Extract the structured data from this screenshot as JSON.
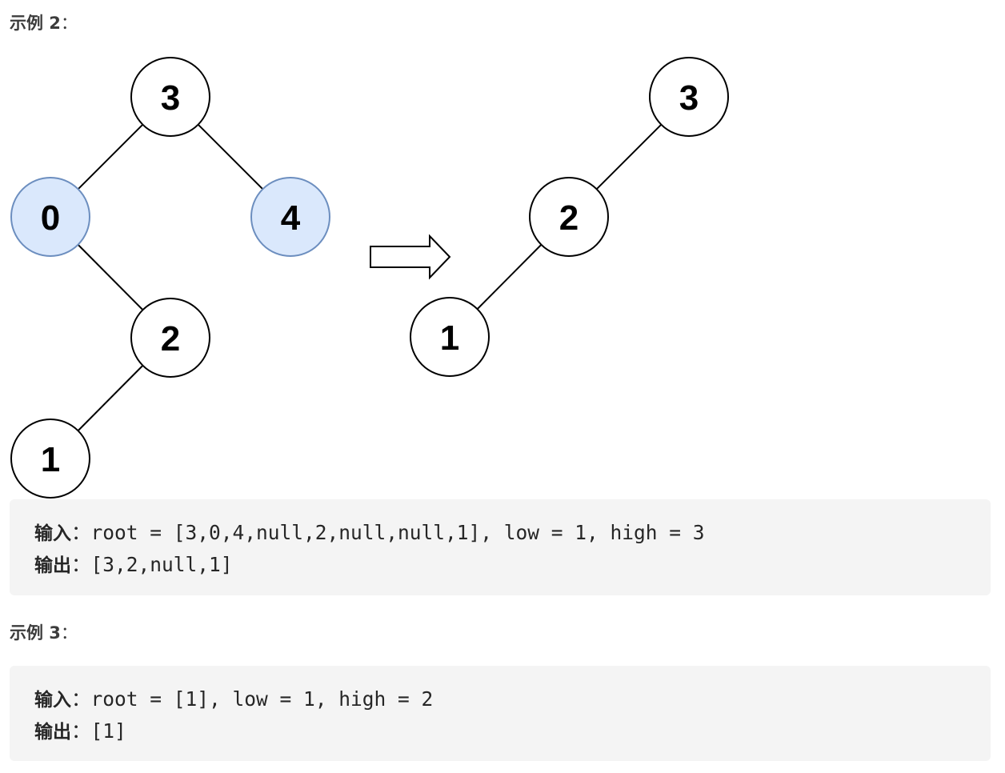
{
  "example2": {
    "heading": "示例 2",
    "colon": "：",
    "diagram": {
      "colors": {
        "highlight_fill": "#dae8fc",
        "highlight_stroke": "#6c8ebf",
        "node_stroke": "#000000"
      },
      "before_tree": {
        "nodes": [
          {
            "id": "a",
            "value": "3",
            "highlighted": false
          },
          {
            "id": "b",
            "value": "0",
            "highlighted": true
          },
          {
            "id": "c",
            "value": "4",
            "highlighted": true
          },
          {
            "id": "d",
            "value": "2",
            "highlighted": false
          },
          {
            "id": "e",
            "value": "1",
            "highlighted": false
          }
        ],
        "edges": [
          [
            "a",
            "b"
          ],
          [
            "a",
            "c"
          ],
          [
            "b",
            "d"
          ],
          [
            "d",
            "e"
          ]
        ]
      },
      "arrow": "right-arrow",
      "after_tree": {
        "nodes": [
          {
            "id": "a",
            "value": "3",
            "highlighted": false
          },
          {
            "id": "d",
            "value": "2",
            "highlighted": false
          },
          {
            "id": "e",
            "value": "1",
            "highlighted": false
          }
        ],
        "edges": [
          [
            "a",
            "d"
          ],
          [
            "d",
            "e"
          ]
        ]
      }
    },
    "input_label": "输入",
    "input_value": "root = [3,0,4,null,2,null,null,1], low = 1, high = 3",
    "output_label": "输出",
    "output_value": "[3,2,null,1]"
  },
  "example3": {
    "heading": "示例 3",
    "colon": "：",
    "input_label": "输入",
    "input_value": "root = [1], low = 1, high = 2",
    "output_label": "输出",
    "output_value": "[1]"
  }
}
